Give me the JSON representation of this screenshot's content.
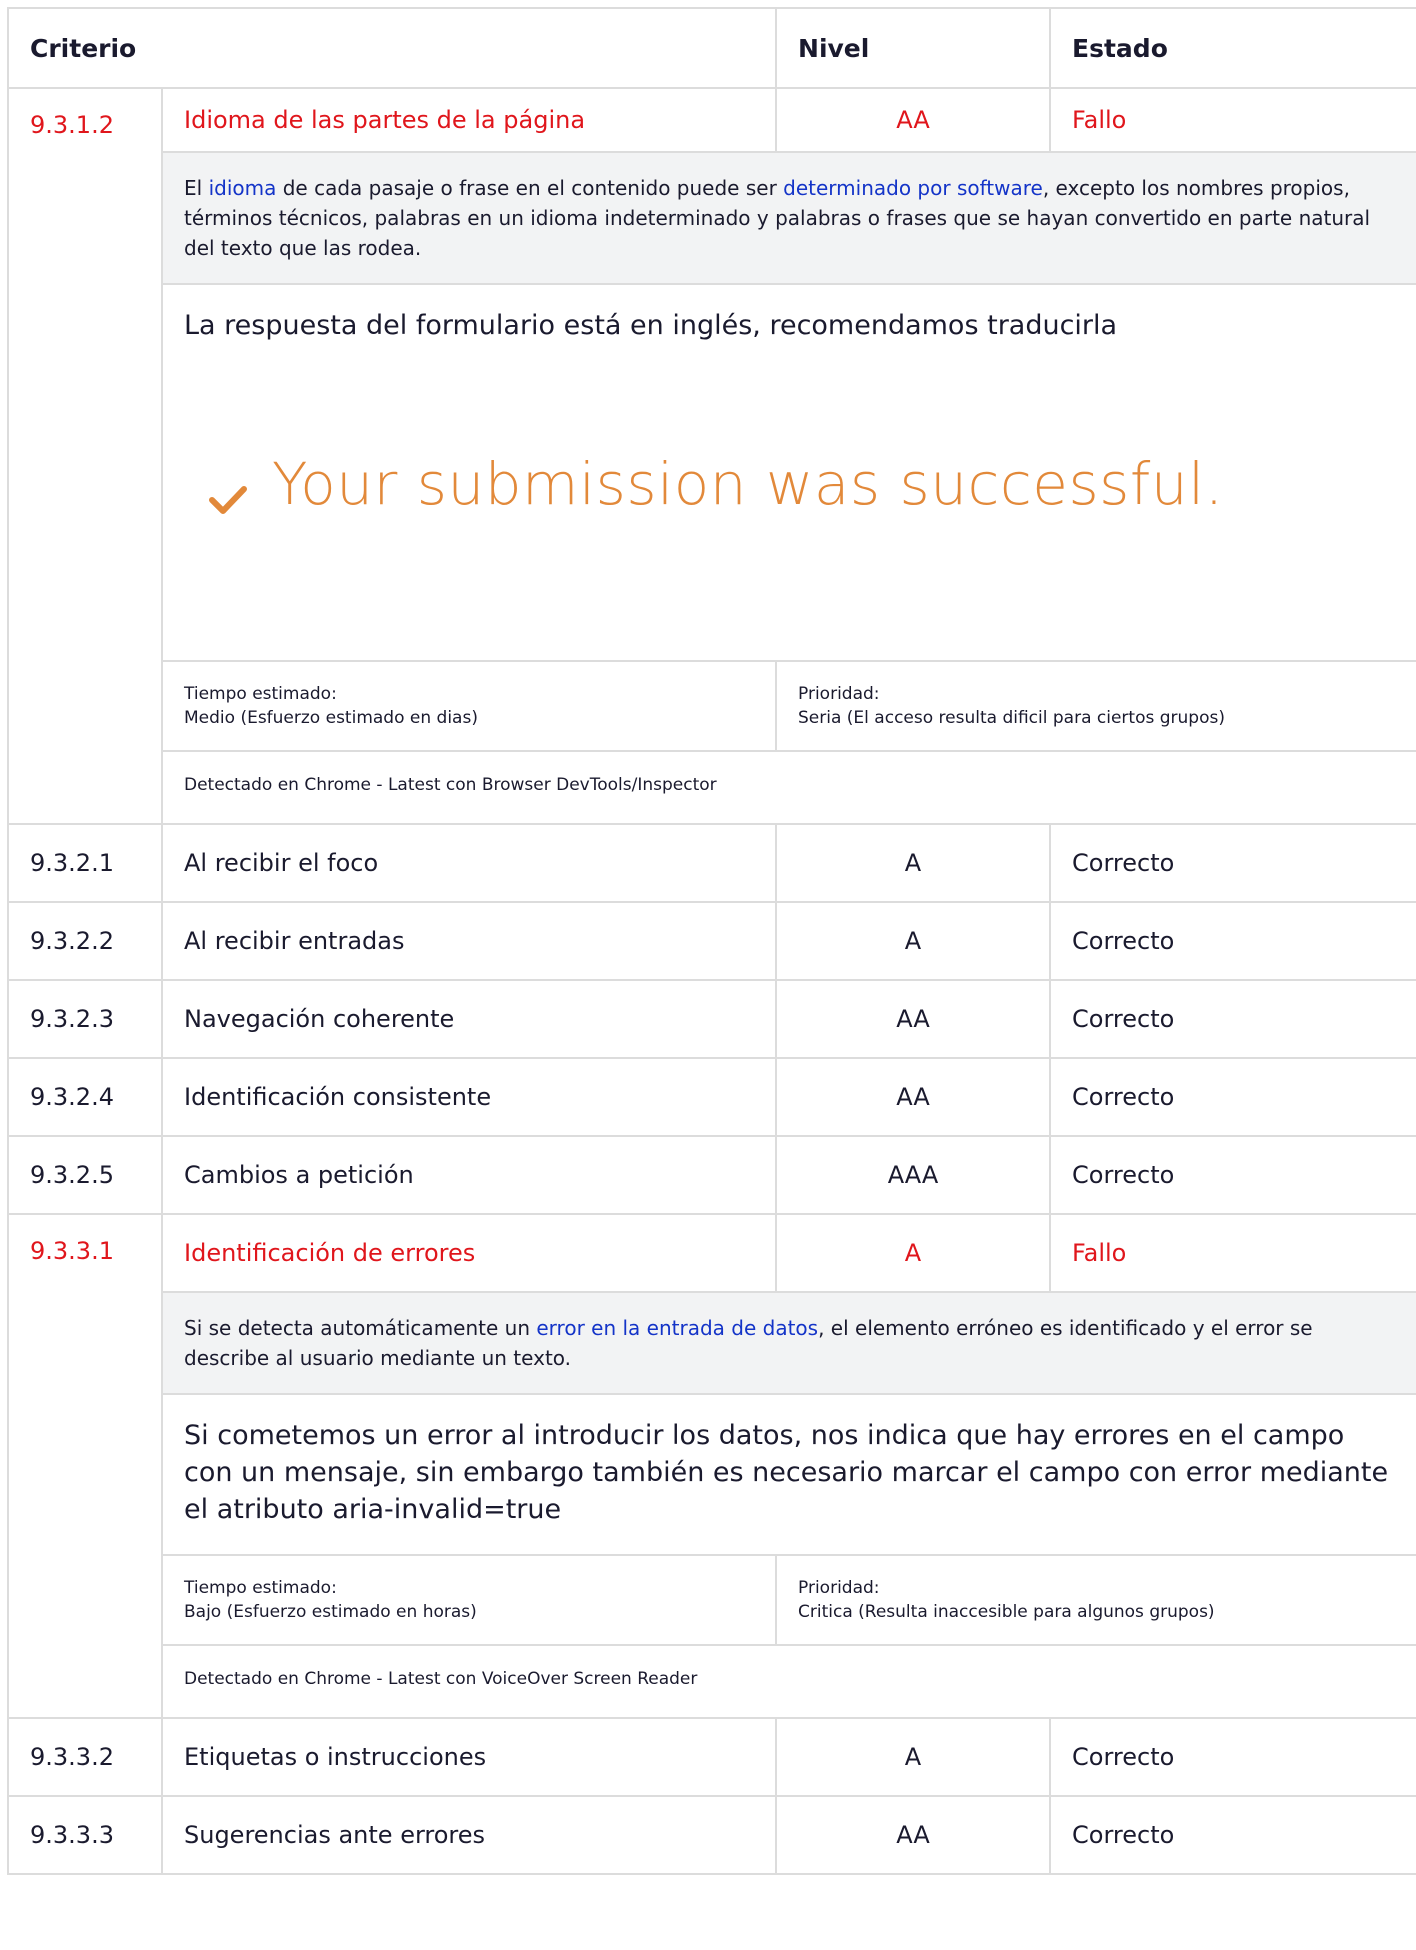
{
  "header": {
    "criterio": "Criterio",
    "nivel": "Nivel",
    "estado": "Estado"
  },
  "rows": [
    {
      "id": "9.3.1.2",
      "name": "Idioma de las partes de la página",
      "level": "AA",
      "status": "Fallo",
      "desc": {
        "before": "El ",
        "link1": "idioma",
        "mid": " de cada pasaje o frase en el contenido puede ser ",
        "link2": "determinado por software",
        "after": ", excepto los nombres propios, términos técnicos, palabras en un idioma indeterminado y palabras o frases que se hayan convertido en parte natural del texto que las rodea."
      },
      "observation": "La respuesta del formulario está en inglés, recomendamos traducirla",
      "screenshot_text": "Your submission was successful.",
      "time_label": "Tiempo estimado:",
      "time_value": "Medio (Esfuerzo estimado en dias)",
      "priority_label": "Prioridad:",
      "priority_value": "Seria (El acceso resulta dificil para ciertos grupos)",
      "detected": "Detectado en Chrome - Latest con Browser DevTools/Inspector"
    },
    {
      "id": "9.3.2.1",
      "name": "Al recibir el foco",
      "level": "A",
      "status": "Correcto"
    },
    {
      "id": "9.3.2.2",
      "name": "Al recibir entradas",
      "level": "A",
      "status": "Correcto"
    },
    {
      "id": "9.3.2.3",
      "name": "Navegación coherente",
      "level": "AA",
      "status": "Correcto"
    },
    {
      "id": "9.3.2.4",
      "name": "Identificación consistente",
      "level": "AA",
      "status": "Correcto"
    },
    {
      "id": "9.3.2.5",
      "name": "Cambios a petición",
      "level": "AAA",
      "status": "Correcto"
    },
    {
      "id": "9.3.3.1",
      "name": "Identificación de errores",
      "level": "A",
      "status": "Fallo",
      "desc": {
        "before": "Si se detecta automáticamente un ",
        "link1": "error en la entrada de datos",
        "after": ", el elemento erróneo es identificado y el error se describe al usuario mediante un texto."
      },
      "observation": "Si cometemos un error al introducir los datos, nos indica que hay errores en el campo con un mensaje, sin embargo también es necesario marcar el campo con error mediante el atributo aria-invalid=true",
      "time_label": "Tiempo estimado:",
      "time_value": "Bajo (Esfuerzo estimado en horas)",
      "priority_label": "Prioridad:",
      "priority_value": "Critica (Resulta inaccesible para algunos grupos)",
      "detected": "Detectado en Chrome - Latest con VoiceOver Screen Reader"
    },
    {
      "id": "9.3.3.2",
      "name": "Etiquetas o instrucciones",
      "level": "A",
      "status": "Correcto"
    },
    {
      "id": "9.3.3.3",
      "name": "Sugerencias ante errores",
      "level": "AA",
      "status": "Correcto"
    }
  ],
  "colors": {
    "fail": "#e0161c",
    "link": "#1434c8",
    "success": "#e2893a",
    "desc_bg": "#f2f3f4"
  },
  "icons": {
    "success": "check-icon"
  }
}
